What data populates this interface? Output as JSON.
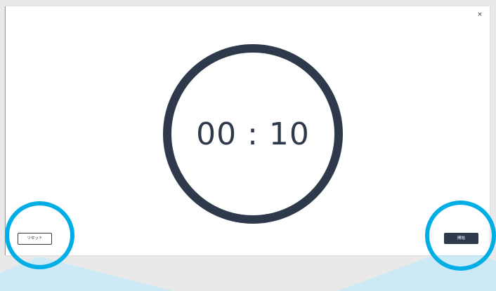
{
  "modal": {
    "close_label": "×"
  },
  "timer": {
    "display": "00 : 10"
  },
  "controls": {
    "reset_label": "リセット",
    "start_label": "開始"
  },
  "colors": {
    "dark": "#2e3a4b",
    "highlight": "#00aee6",
    "beam": "#cfeefb"
  }
}
